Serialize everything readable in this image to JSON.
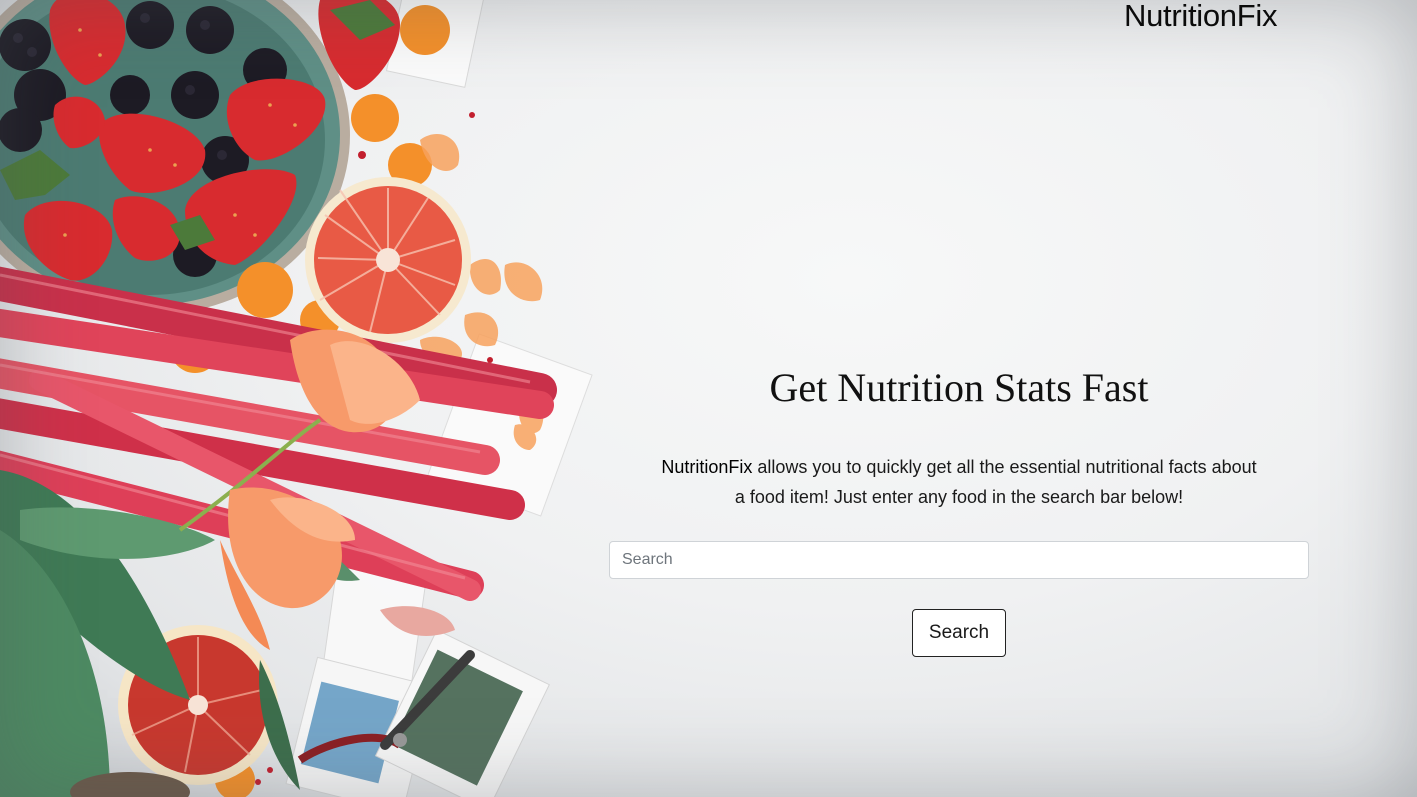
{
  "header": {
    "brand": "NutritionFix"
  },
  "hero": {
    "headline": "Get Nutrition Stats Fast",
    "description_brand": "NutritionFix",
    "description_rest": " allows you to quickly get all the essential nutritional facts about a food item! Just enter any food in the search bar below!"
  },
  "search": {
    "placeholder": "Search",
    "value": "",
    "button_label": "Search"
  }
}
